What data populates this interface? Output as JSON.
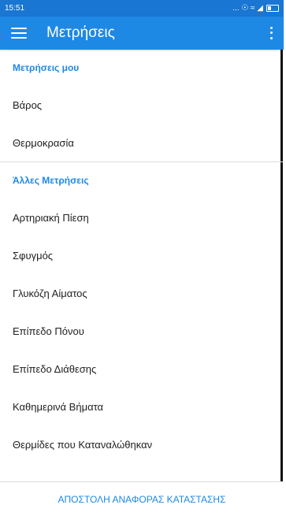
{
  "status_bar": {
    "time": "15:51",
    "indicators": "... ☉ ≈ ◢"
  },
  "toolbar": {
    "title": "Μετρήσεις",
    "menu_icon": "hamburger-menu-icon",
    "more_icon": "more-vert-icon"
  },
  "sections": [
    {
      "header": "Μετρήσεις μου",
      "items": [
        "Βάρος",
        "Θερμοκρασία"
      ]
    },
    {
      "header": "Άλλες Μετρήσεις",
      "items": [
        "Αρτηριακή Πίεση",
        "Σφυγμός",
        "Γλυκόζη Αίματος",
        "Επίπεδο Πόνου",
        "Επίπεδο Διάθεσης",
        "Καθημερινά Βήματα",
        "Θερμίδες που Καταναλώθηκαν"
      ]
    }
  ],
  "footer": {
    "action_label": "ΑΠΟΣΤΟΛΗ ΑΝΑΦΟΡΑΣ ΚΑΤΑΣΤΑΣΗΣ"
  },
  "colors": {
    "primary": "#1e88e5",
    "status_bar": "#1976d2",
    "text": "#212121",
    "divider": "#dcdcdc"
  }
}
